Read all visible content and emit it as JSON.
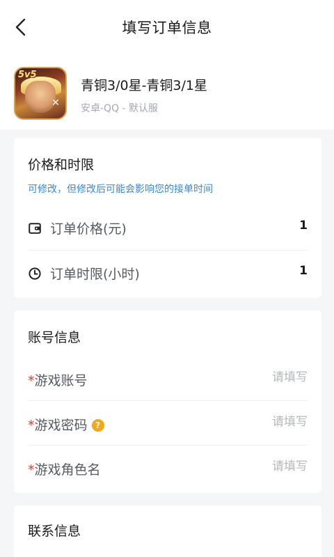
{
  "header": {
    "title": "填写订单信息"
  },
  "game": {
    "name": "青铜3/0星-青铜3/1星",
    "server": "安卓-QQ - 默认服",
    "icon_badge": "5v5",
    "icon_mark": "✕"
  },
  "price_section": {
    "title": "价格和时限",
    "note": "可修改，但修改后可能会影响您的接单时间",
    "price_label": "订单价格(元)",
    "price_value": "1",
    "time_label": "订单时限(小时)",
    "time_value": "1"
  },
  "account_section": {
    "title": "账号信息",
    "required_mark": "*",
    "account_label": "游戏账号",
    "password_label": "游戏密码",
    "role_label": "游戏角色名",
    "help_icon": "?",
    "placeholder": "请填写"
  },
  "contact_section": {
    "title": "联系信息"
  },
  "colors": {
    "accent_blue": "#3a87d8",
    "required_red": "#e53935",
    "help_orange": "#f0a81c"
  },
  "icons": {
    "back": "chevron-left-icon",
    "wallet": "wallet-icon",
    "clock": "clock-icon",
    "help": "question-icon"
  }
}
